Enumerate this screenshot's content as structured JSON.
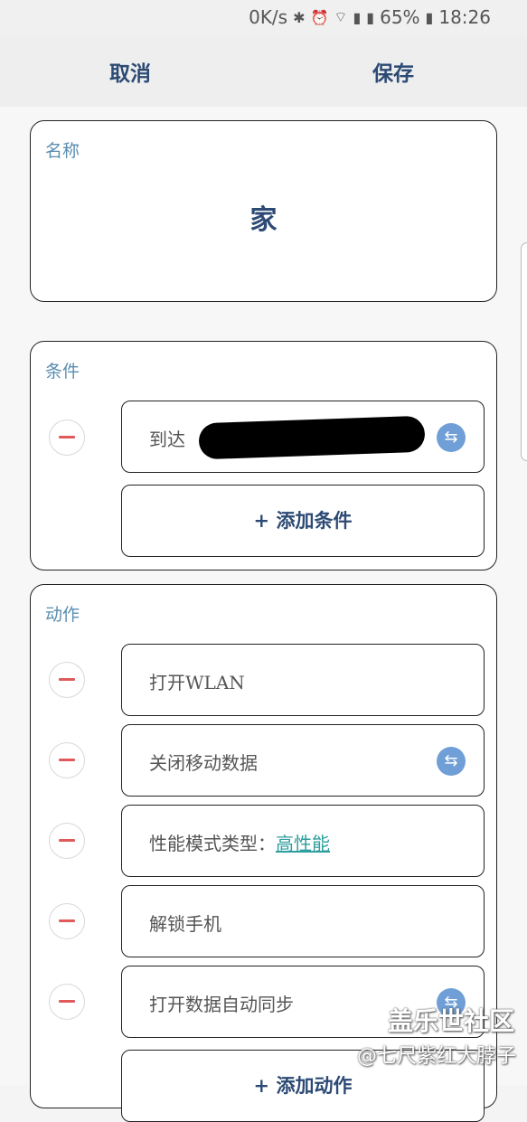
{
  "status_bar": {
    "speed": "0K/s",
    "battery": "65%",
    "time": "18:26",
    "icons": [
      "bluetooth-icon",
      "alarm-icon",
      "wifi-icon",
      "signal-icon",
      "signal-4g-icon",
      "battery-icon"
    ]
  },
  "topbar": {
    "cancel": "取消",
    "save": "保存"
  },
  "name_card": {
    "label": "名称",
    "value": "家"
  },
  "conditions_card": {
    "label": "条件",
    "items": [
      {
        "text": "到达"
      }
    ],
    "add_label": "+ 添加条件"
  },
  "actions_card": {
    "label": "动作",
    "items": [
      {
        "text": "打开WLAN"
      },
      {
        "text": "关闭移动数据"
      },
      {
        "text": "性能模式类型：",
        "link": "高性能"
      },
      {
        "text": "解锁手机"
      },
      {
        "text": "打开数据自动同步"
      }
    ],
    "add_label": "+ 添加动作"
  },
  "watermark": {
    "title": "盖乐世社区",
    "user": "@七尺紫红大脖子"
  },
  "colors": {
    "accent": "#2c4a74",
    "label": "#5a8db0",
    "remove": "#e05a5a",
    "swap": "#6f9fd6",
    "link": "#2e9e9e"
  }
}
